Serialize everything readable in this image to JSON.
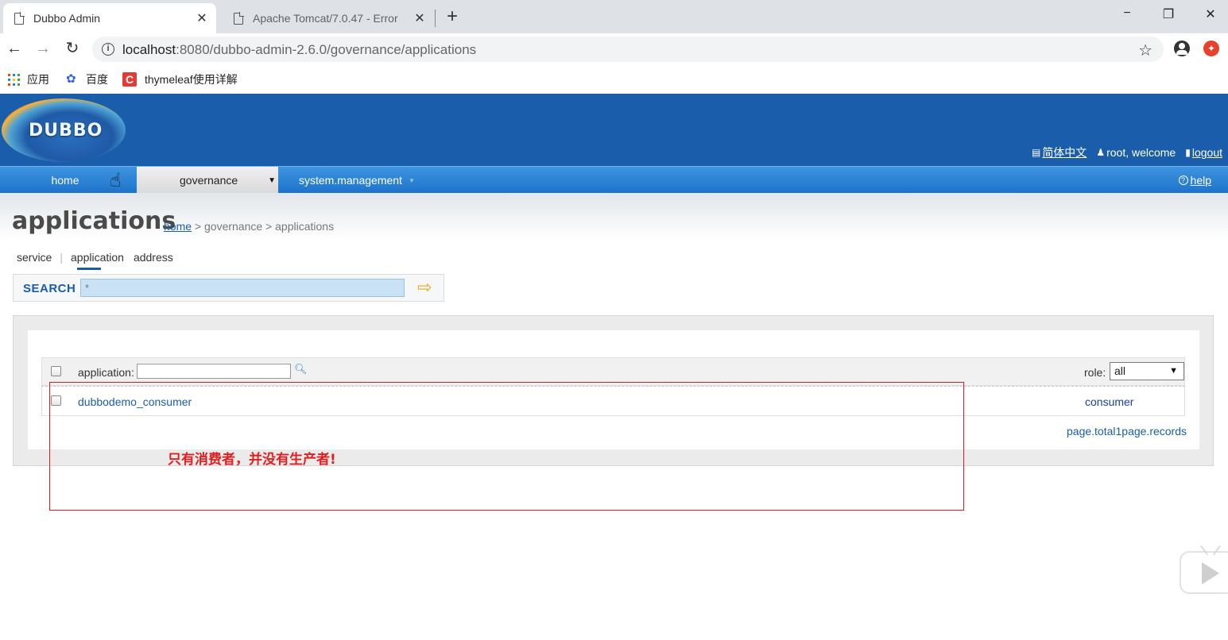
{
  "browser": {
    "tabs": [
      {
        "title": "Dubbo Admin",
        "close": "✕"
      },
      {
        "title": "Apache Tomcat/7.0.47 - Error",
        "close": "✕"
      }
    ],
    "new_tab": "+",
    "window": {
      "minimize": "−",
      "restore": "❐",
      "close": "✕"
    },
    "nav": {
      "back": "←",
      "forward": "→",
      "reload": "↻"
    },
    "url": {
      "host": "localhost",
      "rest": ":8080/dubbo-admin-2.6.0/governance/applications"
    },
    "star": "☆",
    "bookmarks": [
      {
        "label": "应用",
        "icon": "apps-grid-icon"
      },
      {
        "label": "百度",
        "icon": "baidu-paw-icon"
      },
      {
        "label": "thymeleaf使用详解",
        "icon": "csdn-icon"
      }
    ]
  },
  "header": {
    "logo_text": "DUBBO",
    "language": "简体中文",
    "user_text": "root, welcome",
    "logout": "logout"
  },
  "menu": {
    "home": "home",
    "governance": "governance",
    "system": "system.management",
    "caret": "▼",
    "help": "help"
  },
  "page": {
    "title": "applications",
    "breadcrumb": {
      "home": "home",
      "sep": " > ",
      "governance": "governance",
      "current": "applications"
    },
    "subtabs": {
      "service": "service",
      "sep": "|",
      "application": "application",
      "address": "address"
    },
    "search": {
      "label": "SEARCH",
      "value": "*",
      "go": "⇨"
    }
  },
  "table": {
    "filter_label": "application:",
    "role_label": "role:",
    "role_selected": "all",
    "rows": [
      {
        "application": "dubbodemo_consumer",
        "role": "consumer"
      }
    ],
    "page_info": "page.total1page.records"
  },
  "annotation": {
    "text": "只有消费者，并没有生产者!",
    "color": "#e02020"
  },
  "colors": {
    "header_blue": "#1a5eab",
    "menu_blue": "#1d73c9",
    "link_blue": "#1a5eab"
  }
}
